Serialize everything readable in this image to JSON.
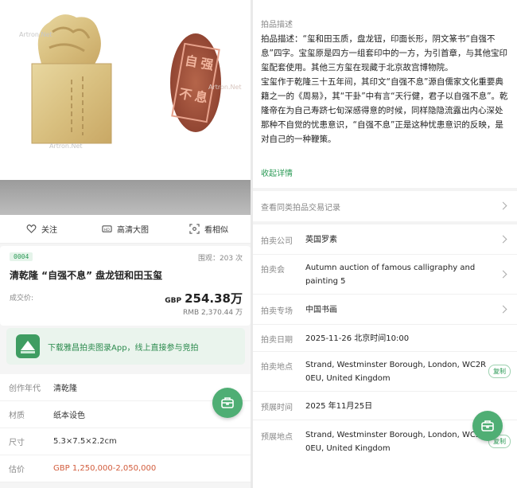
{
  "left": {
    "watermarks": [
      "Artron.Net",
      "Artron.Net",
      "Artron.Net"
    ],
    "seal_text": "自强不息",
    "actions": [
      {
        "icon": "heart-icon",
        "label": "关注"
      },
      {
        "icon": "hd-icon",
        "label": "高清大图"
      },
      {
        "icon": "scan-icon",
        "label": "看相似"
      }
    ],
    "lot": {
      "number": "0004",
      "views": "围观：203 次",
      "title": "清乾隆 “自强不息” 盘龙钮和田玉玺",
      "sold_label": "成交价:",
      "price_currency": "GBP",
      "price_value": "254.38万",
      "price_rmb": "RMB 2,370.44 万"
    },
    "banner": "下载雅昌拍卖图录App，线上直接参与竞拍",
    "info": [
      {
        "key": "创作年代",
        "value": "清乾隆"
      },
      {
        "key": "材质",
        "value": "纸本设色"
      },
      {
        "key": "尺寸",
        "value": "5.3×7.5×2.2cm"
      },
      {
        "key": "估价",
        "value": "GBP  1,250,000-2,050,000"
      }
    ]
  },
  "right": {
    "section_title": "拍品描述",
    "description": [
      "拍品描述：“玺和田玉质，盘龙钮，印面长形，阴文篆书“自强不息”四字。宝玺原是四方一组套印中的一方，为引首章，与其他宝印玺配套使用。其他三方玺在现藏于北京故宫博物院。",
      "宝玺作于乾隆三十五年间，其印文“自强不息”源自儒家文化重要典籍之一的《周易》，其“干卦”中有言“天行健，君子以自强不息”。乾隆帝在为自己寿跻七旬深感得意的时候，同样隐隐流露出内心深处那种不自觉的忧患意识，“自强不息”正是这种忧患意识的反映，是对自己的一种鞭策。"
    ],
    "collapse": "收起详情",
    "similar": "查看同类拍品交易记录",
    "rows": [
      {
        "key": "拍卖公司",
        "value": "英国罗素"
      },
      {
        "key": "拍卖会",
        "value": "Autumn auction of famous calligraphy and painting 5"
      },
      {
        "key": "拍卖专场",
        "value": "中国书画"
      },
      {
        "key": "拍卖日期",
        "value": "2025-11-26 北京时间10:00"
      },
      {
        "key": "拍卖地点",
        "value": "Strand, Westminster Borough, London, WC2R 0EU, United Kingdom"
      },
      {
        "key": "预展时间",
        "value": "2025 年11月25日"
      },
      {
        "key": "预展地点",
        "value": "Strand, Westminster Borough, London, WC2R 0EU, United Kingdom"
      }
    ],
    "copy_label": "复制"
  },
  "colors": {
    "accent": "#2b9a56",
    "fab": "#4fae74",
    "estimate": "#d25c3c"
  }
}
